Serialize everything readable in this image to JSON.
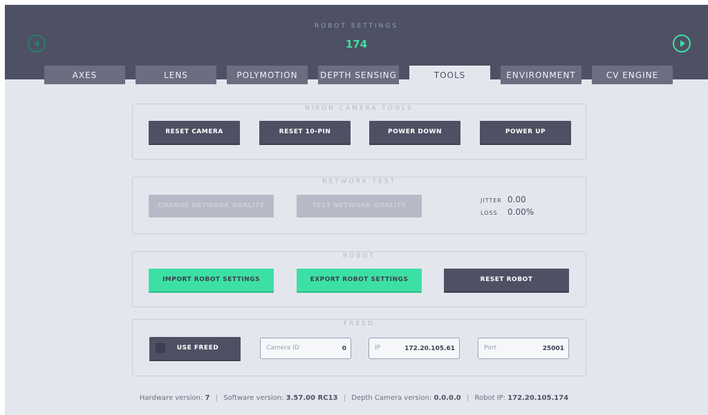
{
  "header": {
    "title": "ROBOT SETTINGS",
    "robot_number": "174",
    "prev_icon": "chevron-left-circle-icon",
    "next_icon": "chevron-right-circle-icon"
  },
  "tabs": [
    {
      "label": "AXES",
      "active": false
    },
    {
      "label": "LENS",
      "active": false
    },
    {
      "label": "POLYMOTION",
      "active": false
    },
    {
      "label": "DEPTH SENSING",
      "active": false
    },
    {
      "label": "TOOLS",
      "active": true
    },
    {
      "label": "ENVIRONMENT",
      "active": false
    },
    {
      "label": "CV ENGINE",
      "active": false
    }
  ],
  "nikon": {
    "legend": "NIKON CAMERA TOOLS",
    "buttons": [
      "RESET CAMERA",
      "RESET 10-PIN",
      "POWER DOWN",
      "POWER UP"
    ]
  },
  "network": {
    "legend": "NETWORK TEST",
    "buttons": [
      "CHANGE NETWORK QUALITY",
      "TEST NETWORK QUALITY"
    ],
    "jitter_label": "JITTER",
    "jitter_value": "0.00",
    "loss_label": "LOSS",
    "loss_value": "0.00%"
  },
  "robot": {
    "legend": "ROBOT",
    "buttons": [
      "IMPORT ROBOT SETTINGS",
      "EXPORT ROBOT SETTINGS",
      "RESET ROBOT"
    ]
  },
  "freed": {
    "legend": "FREED",
    "use_freed_label": "USE FREED",
    "use_freed_checked": false,
    "camera_id_label": "Camera ID",
    "camera_id_value": "0",
    "ip_label": "IP",
    "ip_value": "172.20.105.61",
    "port_label": "Port",
    "port_value": "25001"
  },
  "footer": {
    "hardware_label": "Hardware version:",
    "hardware_value": "7",
    "software_label": "Software version:",
    "software_value": "3.57.00 RC13",
    "depth_label": "Depth Camera version:",
    "depth_value": "0.0.0.0",
    "ip_label": "Robot IP:",
    "ip_value": "172.20.105.174"
  },
  "colors": {
    "header_bg": "#4d5163",
    "tab_bg": "#6a6e80",
    "content_bg": "#e4e6ee",
    "accent_green": "#3de0a4",
    "dark_button": "#4d5163"
  }
}
